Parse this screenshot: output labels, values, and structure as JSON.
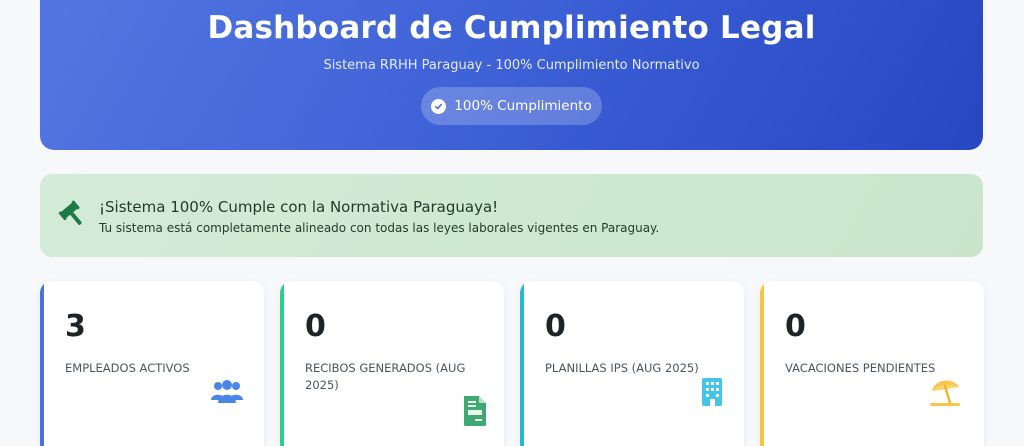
{
  "header": {
    "title": "Dashboard de Cumplimiento Legal",
    "subtitle": "Sistema RRHH Paraguay - 100% Cumplimiento Normativo",
    "badge_label": "100% Cumplimiento"
  },
  "alert": {
    "icon": "gavel-icon",
    "title": "¡Sistema 100% Cumple con la Normativa Paraguaya!",
    "text": "Tu sistema está completamente alineado con todas las leyes laborales vigentes en Paraguay."
  },
  "stats": [
    {
      "value": "3",
      "label": "EMPLEADOS ACTIVOS",
      "icon": "users-icon",
      "accent": "#4a6fe0"
    },
    {
      "value": "0",
      "label": "RECIBOS GENERADOS (AUG 2025)",
      "icon": "invoice-icon",
      "accent": "#2ecc8f"
    },
    {
      "value": "0",
      "label": "PLANILLAS IPS (AUG 2025)",
      "icon": "building-icon",
      "accent": "#26b7d3"
    },
    {
      "value": "0",
      "label": "VACACIONES PENDIENTES",
      "icon": "beach-umbrella-icon",
      "accent": "#f5c542"
    }
  ],
  "colors": {
    "header_start": "#4a6fe0",
    "header_end": "#2747c2",
    "alert_bg": "#d3ebd7",
    "alert_icon": "#1e7a45"
  }
}
